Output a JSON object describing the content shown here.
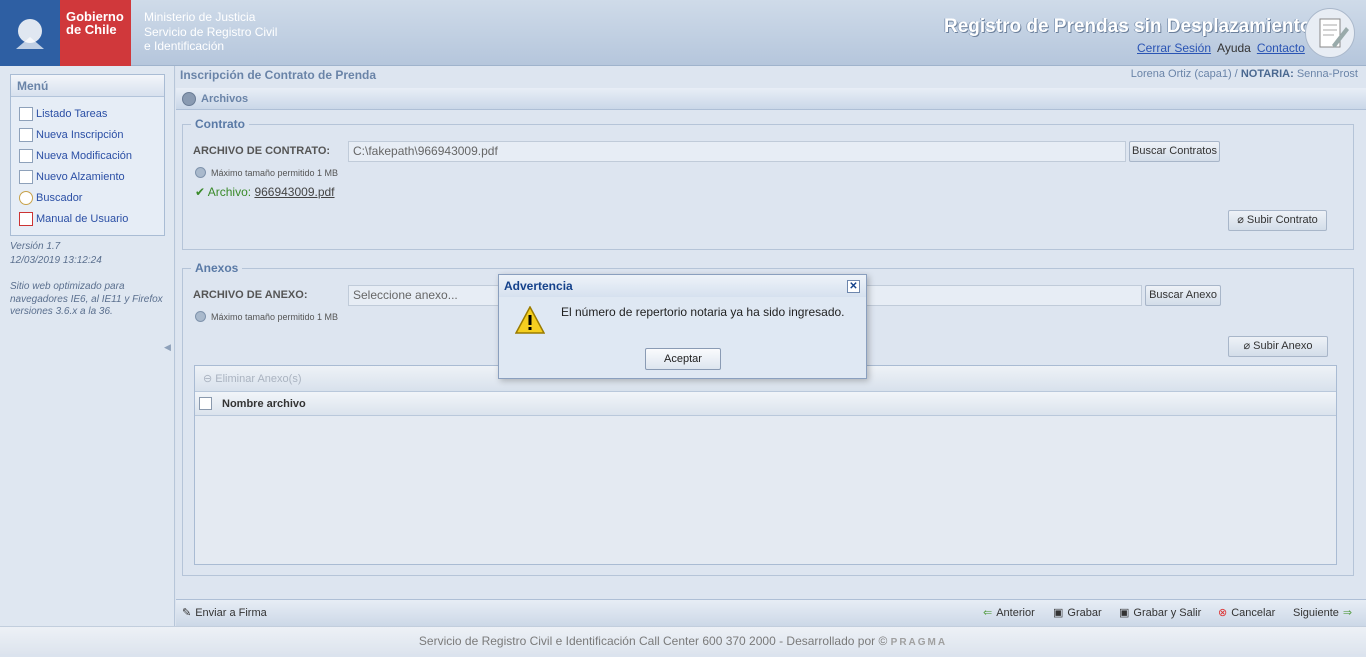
{
  "header": {
    "brand_line1": "Gobierno",
    "brand_line2": "de Chile",
    "ministry_line1": "Ministerio de Justicia",
    "ministry_line2": "Servicio de Registro Civil",
    "ministry_line3": "e Identificación",
    "app_title": "Registro de Prendas sin Desplazamiento",
    "logout": "Cerrar Sesión",
    "help": "Ayuda",
    "contact": "Contacto"
  },
  "sidebar": {
    "title": "Menú",
    "items": [
      {
        "label": "Listado Tareas",
        "icon": "list-icon"
      },
      {
        "label": "Nueva Inscripción",
        "icon": "new-document-icon"
      },
      {
        "label": "Nueva Modificación",
        "icon": "edit-document-icon"
      },
      {
        "label": "Nuevo Alzamiento",
        "icon": "lift-document-icon"
      },
      {
        "label": "Buscador",
        "icon": "search-icon"
      },
      {
        "label": "Manual de Usuario",
        "icon": "pdf-icon"
      }
    ],
    "version": "Versión 1.7",
    "datetime": "12/03/2019 13:12:24",
    "note": "Sitio web optimizado para navegadores IE6, al IE11 y Firefox versiones 3.6.x a la 36."
  },
  "main": {
    "breadcrumb": "Inscripción de Contrato de Prenda",
    "user_name": "Lorena Ortiz (capa1) /",
    "user_notaria_label": "NOTARIA:",
    "user_notaria": "Senna-Prost",
    "panel_title": "Archivos",
    "contrato": {
      "legend": "Contrato",
      "label": "ARCHIVO DE CONTRATO:",
      "value": "C:\\fakepath\\966943009.pdf",
      "browse": "Buscar Contratos",
      "hint": "Máximo tamaño permitido 1 MB",
      "file_label": "Archivo:",
      "file_name": "966943009.pdf",
      "upload": "Subir Contrato"
    },
    "anexos": {
      "legend": "Anexos",
      "label": "ARCHIVO DE ANEXO:",
      "placeholder": "Seleccione anexo...",
      "browse": "Buscar Anexo",
      "hint": "Máximo tamaño permitido 1 MB",
      "upload": "Subir Anexo",
      "delete": "Eliminar Anexo(s)",
      "col_name": "Nombre archivo"
    }
  },
  "footer_bar": {
    "send_signature": "Enviar a Firma",
    "previous": "Anterior",
    "save": "Grabar",
    "save_exit": "Grabar y Salir",
    "cancel": "Cancelar",
    "next": "Siguiente"
  },
  "footer": {
    "text": "Servicio de Registro Civil e Identificación   Call Center 600 370 2000 - Desarrollado por ©",
    "brand": "PRAGMA"
  },
  "dialog": {
    "title": "Advertencia",
    "message": "El número de repertorio notaria ya ha sido ingresado.",
    "ok": "Aceptar"
  },
  "colors": {
    "brand_blue": "#2e5fa3",
    "brand_red": "#d0383b",
    "link": "#2a54b4"
  }
}
